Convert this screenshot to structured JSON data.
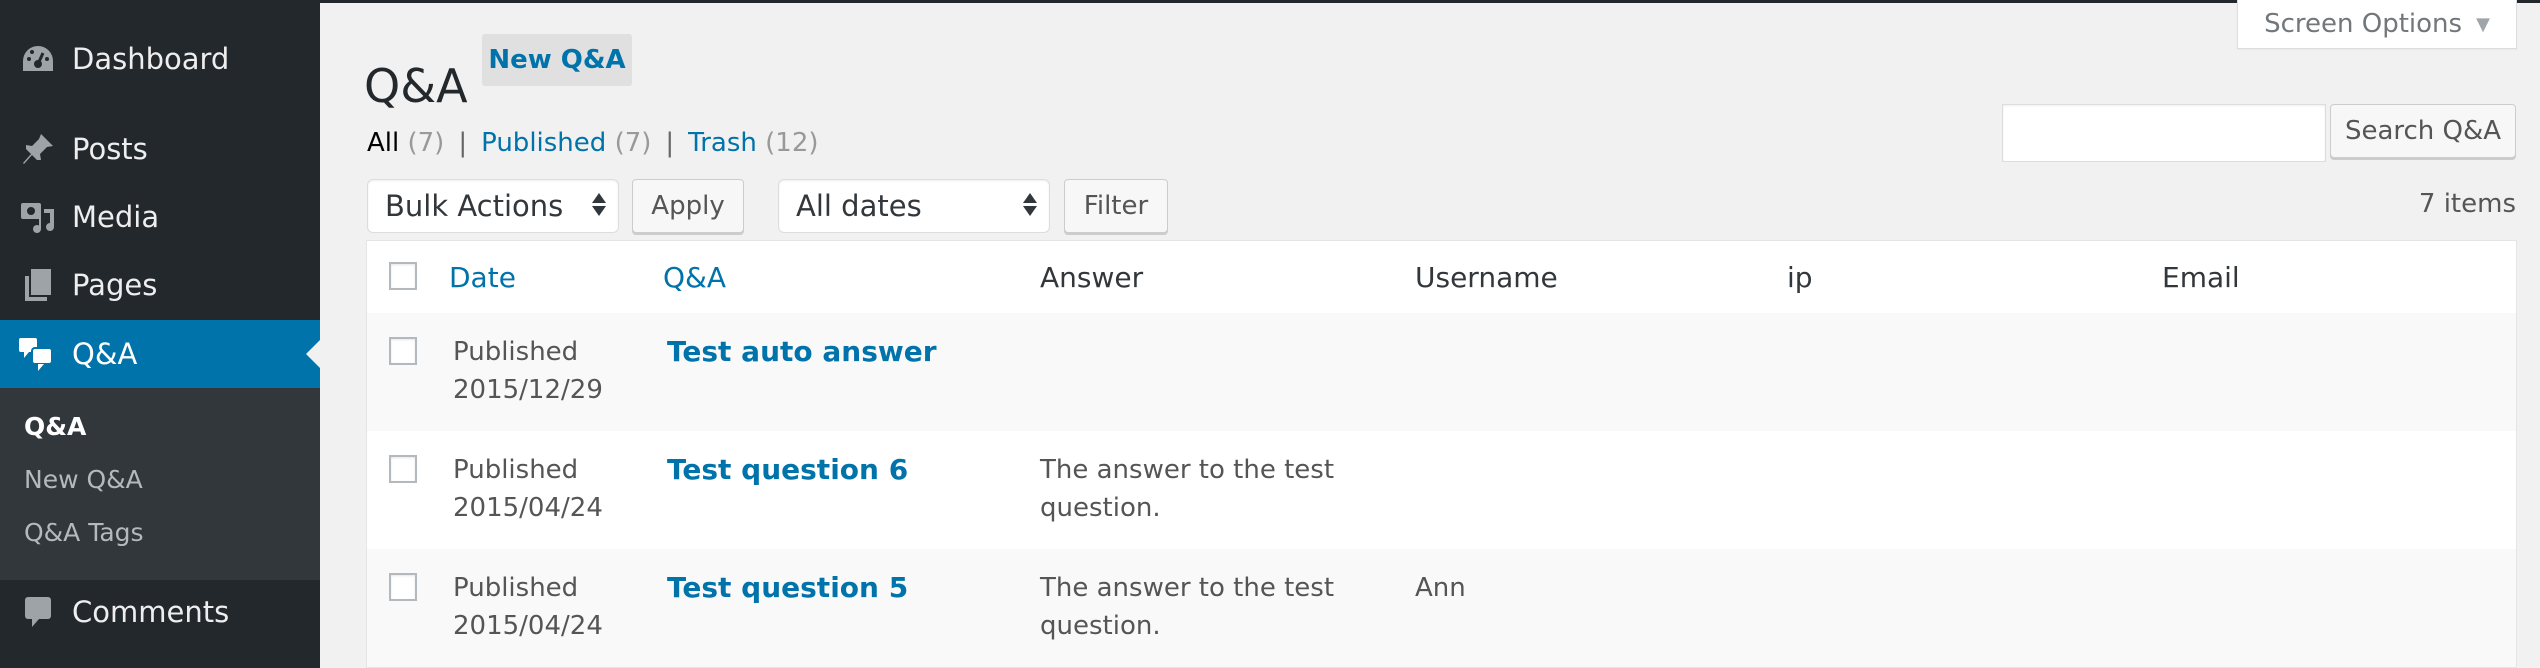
{
  "sidebar": {
    "items": [
      {
        "label": "Dashboard",
        "icon": "dashboard-icon"
      },
      {
        "label": "Posts",
        "icon": "pin-icon"
      },
      {
        "label": "Media",
        "icon": "media-icon"
      },
      {
        "label": "Pages",
        "icon": "pages-icon"
      },
      {
        "label": "Q&A",
        "icon": "speech-bubbles-icon",
        "active": true
      },
      {
        "label": "Comments",
        "icon": "comment-icon"
      }
    ],
    "submenu": [
      {
        "label": "Q&A",
        "current": true
      },
      {
        "label": "New Q&A"
      },
      {
        "label": "Q&A Tags"
      }
    ]
  },
  "header": {
    "title": "Q&A",
    "new_button": "New Q&A",
    "screen_options": "Screen Options"
  },
  "views": {
    "all_label": "All",
    "all_count": "(7)",
    "published_label": "Published",
    "published_count": "(7)",
    "trash_label": "Trash",
    "trash_count": "(12)",
    "separator": "|"
  },
  "search": {
    "value": "",
    "placeholder": "",
    "button": "Search Q&A"
  },
  "toolbar": {
    "bulk_actions": "Bulk Actions",
    "apply": "Apply",
    "dates": "All dates",
    "filter": "Filter",
    "items_count": "7 items"
  },
  "table": {
    "columns": [
      "Date",
      "Q&A",
      "Answer",
      "Username",
      "ip",
      "Email"
    ],
    "rows": [
      {
        "status": "Published",
        "date": "2015/12/29",
        "title": "Test auto answer",
        "answer": "",
        "username": "",
        "ip": "",
        "email": ""
      },
      {
        "status": "Published",
        "date": "2015/04/24",
        "title": "Test question 6",
        "answer_line1": "The answer to the test",
        "answer_line2": "question.",
        "username": "",
        "ip": "",
        "email": ""
      },
      {
        "status": "Published",
        "date": "2015/04/24",
        "title": "Test question 5",
        "answer_line1": "The answer to the test",
        "answer_line2": "question.",
        "username": "Ann",
        "ip": "",
        "email": ""
      }
    ]
  },
  "colors": {
    "sidebar_bg": "#23282d",
    "accent": "#0073aa",
    "page_bg": "#f1f1f1"
  }
}
